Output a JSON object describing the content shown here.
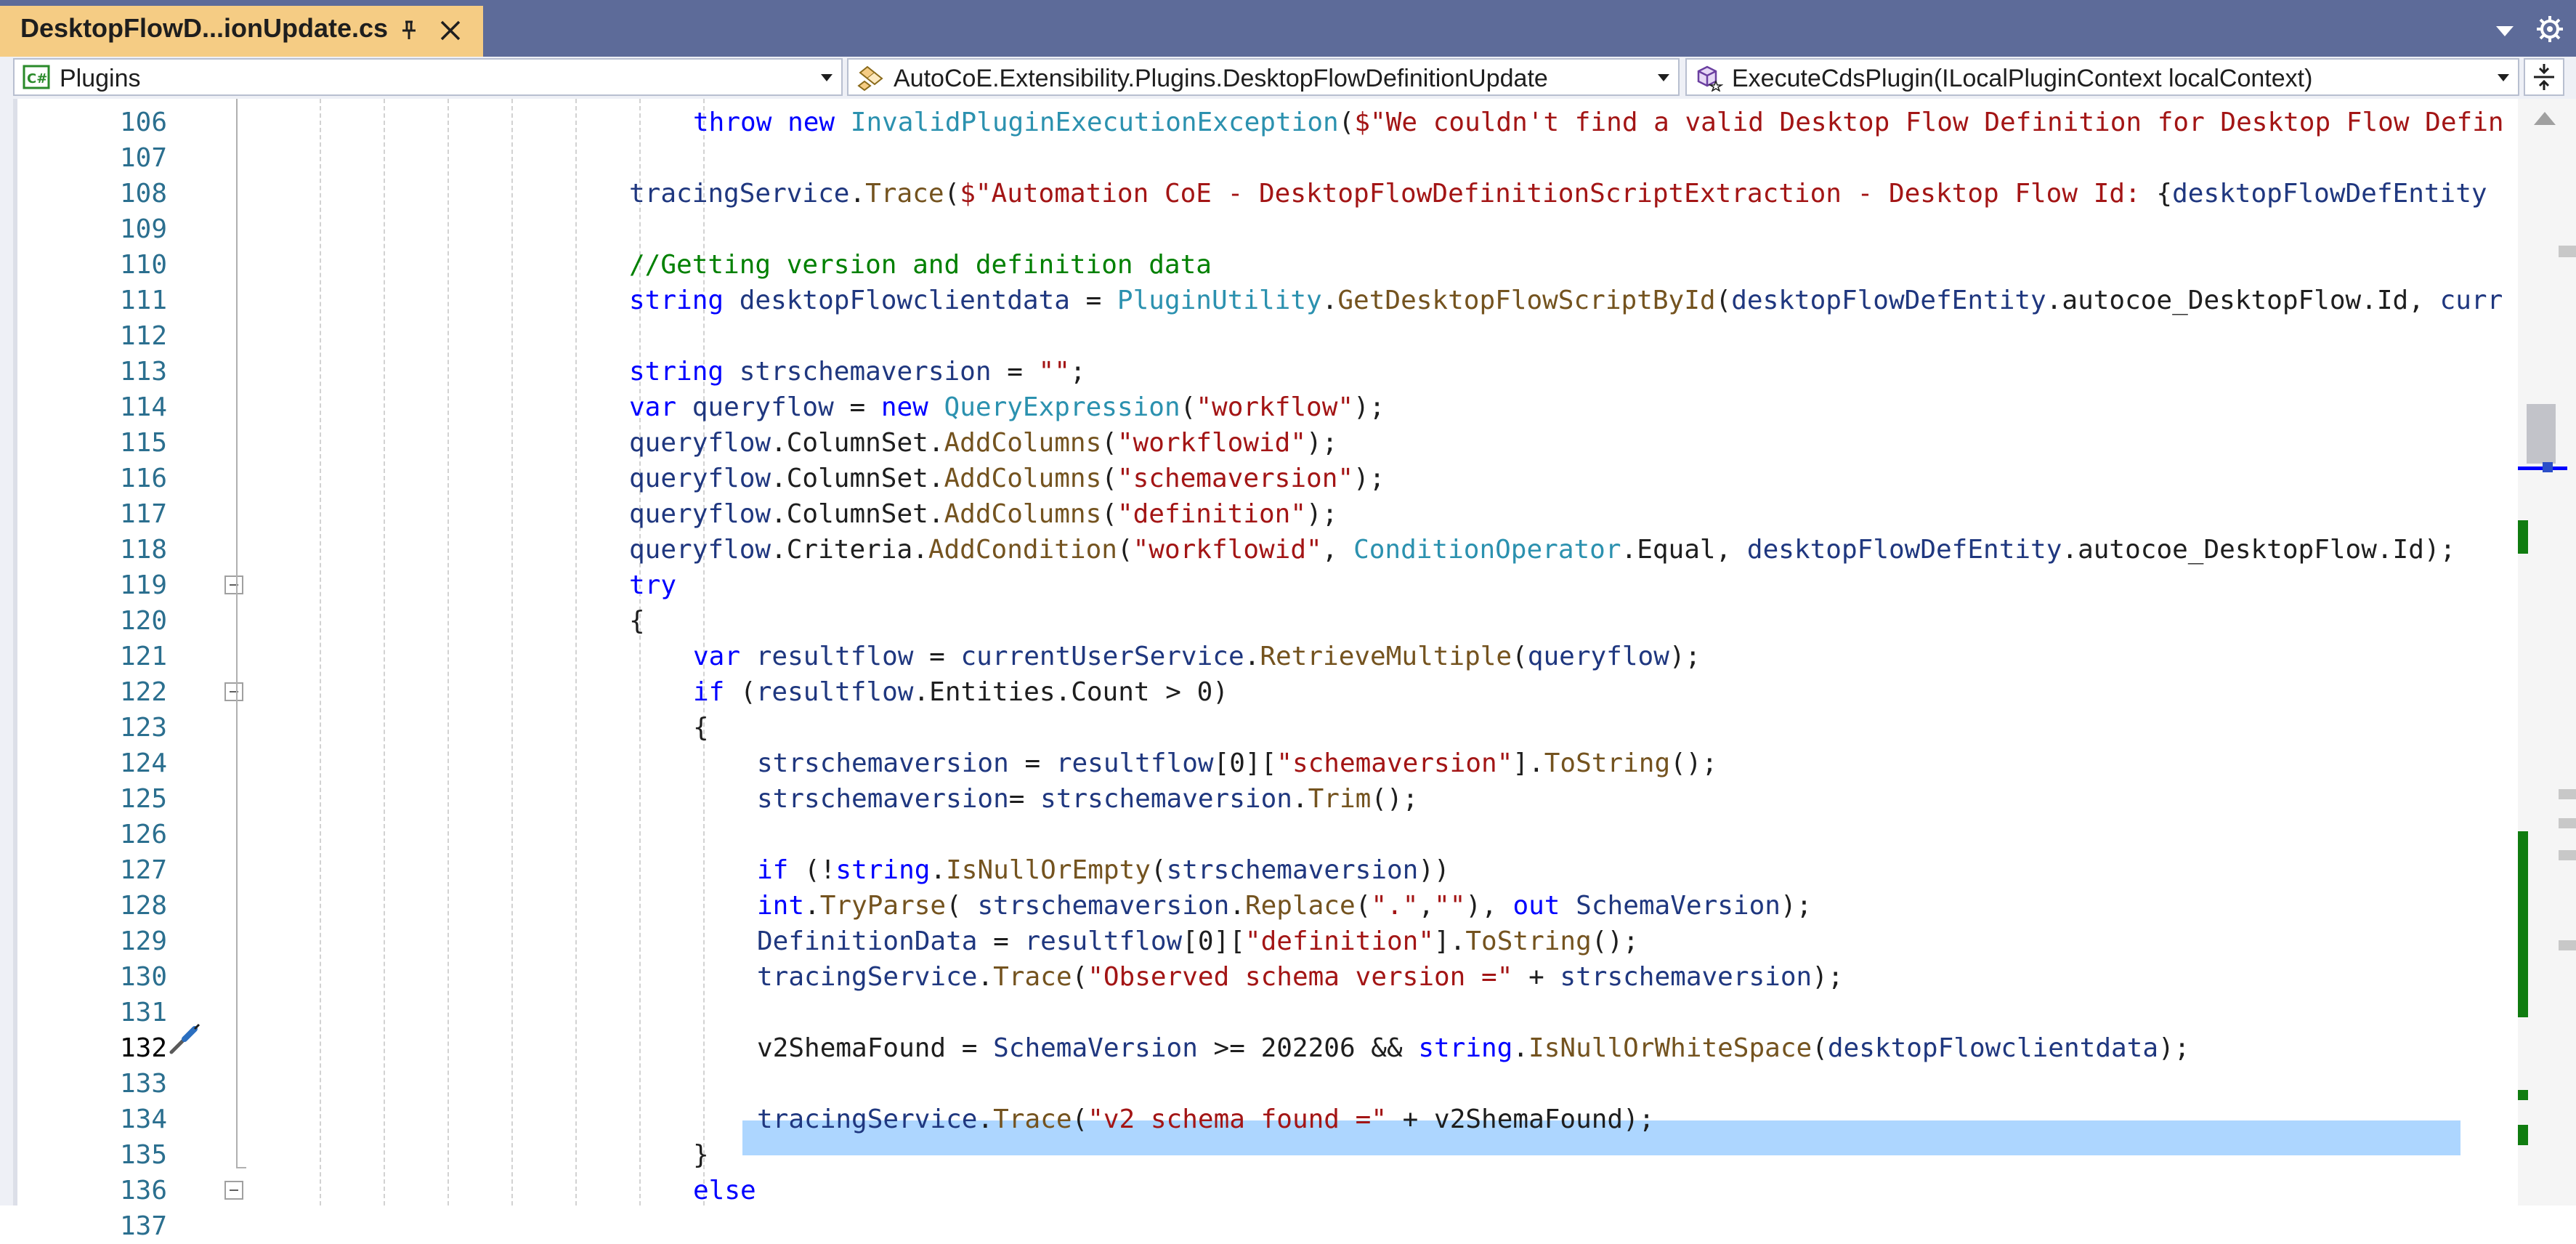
{
  "tab": {
    "title": "DesktopFlowD...ionUpdate.cs",
    "pin_icon": "pin-icon",
    "close_icon": "close-icon"
  },
  "window": {
    "overflow_icon": "chevron-down-icon",
    "settings_icon": "gear-icon"
  },
  "navbar": {
    "project": "Plugins",
    "type": "AutoCoE.Extensibility.Plugins.DesktopFlowDefinitionUpdate",
    "member": "ExecuteCdsPlugin(ILocalPluginContext localContext)"
  },
  "editor": {
    "current_line": "132",
    "colors": {
      "keyword": "#0000ff",
      "type": "#2b91af",
      "string": "#a31515",
      "comment": "#008000",
      "method": "#74531f",
      "variable": "#1f377f",
      "selection": "#add6ff"
    },
    "lines": [
      {
        "num": "106",
        "indent": 2,
        "tokens": [
          [
            "kw",
            "throw"
          ],
          [
            "p",
            " "
          ],
          [
            "kw",
            "new"
          ],
          [
            "p",
            " "
          ],
          [
            "ty",
            "InvalidPluginExecutionException"
          ],
          [
            "p",
            "("
          ],
          [
            "str",
            "$\"We couldn't find a valid Desktop Flow Definition for Desktop Flow Defin"
          ]
        ]
      },
      {
        "num": "107",
        "indent": 0,
        "tokens": []
      },
      {
        "num": "108",
        "indent": 1,
        "tokens": [
          [
            "vr",
            "tracingService"
          ],
          [
            "p",
            "."
          ],
          [
            "mt",
            "Trace"
          ],
          [
            "p",
            "("
          ],
          [
            "str",
            "$\"Automation CoE - DesktopFlowDefinitionScriptExtraction - Desktop Flow Id: "
          ],
          [
            "p",
            "{"
          ],
          [
            "vr",
            "desktopFlowDefEntity"
          ]
        ]
      },
      {
        "num": "109",
        "indent": 0,
        "tokens": []
      },
      {
        "num": "110",
        "indent": 1,
        "tokens": [
          [
            "cm",
            "//Getting version and definition data"
          ]
        ]
      },
      {
        "num": "111",
        "indent": 1,
        "tokens": [
          [
            "kw",
            "string"
          ],
          [
            "p",
            " "
          ],
          [
            "vr",
            "desktopFlowclientdata"
          ],
          [
            "p",
            " = "
          ],
          [
            "ty",
            "PluginUtility"
          ],
          [
            "p",
            "."
          ],
          [
            "mt",
            "GetDesktopFlowScriptById"
          ],
          [
            "p",
            "("
          ],
          [
            "vr",
            "desktopFlowDefEntity"
          ],
          [
            "p",
            ".autocoe_DesktopFlow.Id, "
          ],
          [
            "vr",
            "curr"
          ]
        ]
      },
      {
        "num": "112",
        "indent": 0,
        "tokens": []
      },
      {
        "num": "113",
        "indent": 1,
        "tokens": [
          [
            "kw",
            "string"
          ],
          [
            "p",
            " "
          ],
          [
            "vr",
            "strschemaversion"
          ],
          [
            "p",
            " = "
          ],
          [
            "str",
            "\"\""
          ],
          [
            "p",
            ";"
          ]
        ]
      },
      {
        "num": "114",
        "indent": 1,
        "tokens": [
          [
            "kw",
            "var"
          ],
          [
            "p",
            " "
          ],
          [
            "vr",
            "queryflow"
          ],
          [
            "p",
            " = "
          ],
          [
            "kw",
            "new"
          ],
          [
            "p",
            " "
          ],
          [
            "ty",
            "QueryExpression"
          ],
          [
            "p",
            "("
          ],
          [
            "str",
            "\"workflow\""
          ],
          [
            "p",
            ");"
          ]
        ]
      },
      {
        "num": "115",
        "indent": 1,
        "tokens": [
          [
            "vr",
            "queryflow"
          ],
          [
            "p",
            ".ColumnSet."
          ],
          [
            "mt",
            "AddColumns"
          ],
          [
            "p",
            "("
          ],
          [
            "str",
            "\"workflowid\""
          ],
          [
            "p",
            ");"
          ]
        ]
      },
      {
        "num": "116",
        "indent": 1,
        "tokens": [
          [
            "vr",
            "queryflow"
          ],
          [
            "p",
            ".ColumnSet."
          ],
          [
            "mt",
            "AddColumns"
          ],
          [
            "p",
            "("
          ],
          [
            "str",
            "\"schemaversion\""
          ],
          [
            "p",
            ");"
          ]
        ]
      },
      {
        "num": "117",
        "indent": 1,
        "tokens": [
          [
            "vr",
            "queryflow"
          ],
          [
            "p",
            ".ColumnSet."
          ],
          [
            "mt",
            "AddColumns"
          ],
          [
            "p",
            "("
          ],
          [
            "str",
            "\"definition\""
          ],
          [
            "p",
            ");"
          ]
        ]
      },
      {
        "num": "118",
        "indent": 1,
        "tokens": [
          [
            "vr",
            "queryflow"
          ],
          [
            "p",
            ".Criteria."
          ],
          [
            "mt",
            "AddCondition"
          ],
          [
            "p",
            "("
          ],
          [
            "str",
            "\"workflowid\""
          ],
          [
            "p",
            ", "
          ],
          [
            "ty",
            "ConditionOperator"
          ],
          [
            "p",
            ".Equal, "
          ],
          [
            "vr",
            "desktopFlowDefEntity"
          ],
          [
            "p",
            ".autocoe_DesktopFlow.Id);"
          ]
        ]
      },
      {
        "num": "119",
        "indent": 1,
        "tokens": [
          [
            "kw",
            "try"
          ]
        ],
        "fold": true
      },
      {
        "num": "120",
        "indent": 1,
        "tokens": [
          [
            "p",
            "{"
          ]
        ]
      },
      {
        "num": "121",
        "indent": 2,
        "tokens": [
          [
            "kw",
            "var"
          ],
          [
            "p",
            " "
          ],
          [
            "vr",
            "resultflow"
          ],
          [
            "p",
            " = "
          ],
          [
            "vr",
            "currentUserService"
          ],
          [
            "p",
            "."
          ],
          [
            "mt",
            "RetrieveMultiple"
          ],
          [
            "p",
            "("
          ],
          [
            "vr",
            "queryflow"
          ],
          [
            "p",
            ");"
          ]
        ]
      },
      {
        "num": "122",
        "indent": 2,
        "tokens": [
          [
            "kw",
            "if"
          ],
          [
            "p",
            " ("
          ],
          [
            "vr",
            "resultflow"
          ],
          [
            "p",
            ".Entities.Count > 0)"
          ]
        ],
        "fold": true
      },
      {
        "num": "123",
        "indent": 2,
        "tokens": [
          [
            "p",
            "{"
          ]
        ]
      },
      {
        "num": "124",
        "indent": 3,
        "tokens": [
          [
            "vr",
            "strschemaversion"
          ],
          [
            "p",
            " = "
          ],
          [
            "vr",
            "resultflow"
          ],
          [
            "p",
            "[0]["
          ],
          [
            "str",
            "\"schemaversion\""
          ],
          [
            "p",
            "]."
          ],
          [
            "mt",
            "ToString"
          ],
          [
            "p",
            "();"
          ]
        ]
      },
      {
        "num": "125",
        "indent": 3,
        "tokens": [
          [
            "vr",
            "strschemaversion"
          ],
          [
            "p",
            "= "
          ],
          [
            "vr",
            "strschemaversion"
          ],
          [
            "p",
            "."
          ],
          [
            "mt",
            "Trim"
          ],
          [
            "p",
            "();"
          ]
        ]
      },
      {
        "num": "126",
        "indent": 0,
        "tokens": []
      },
      {
        "num": "127",
        "indent": 3,
        "tokens": [
          [
            "kw",
            "if"
          ],
          [
            "p",
            " (!"
          ],
          [
            "kw",
            "string"
          ],
          [
            "p",
            "."
          ],
          [
            "mt",
            "IsNullOrEmpty"
          ],
          [
            "p",
            "("
          ],
          [
            "vr",
            "strschemaversion"
          ],
          [
            "p",
            "))"
          ]
        ]
      },
      {
        "num": "128",
        "indent": 3,
        "tokens": [
          [
            "kw",
            "int"
          ],
          [
            "p",
            "."
          ],
          [
            "mt",
            "TryParse"
          ],
          [
            "p",
            "( "
          ],
          [
            "vr",
            "strschemaversion"
          ],
          [
            "p",
            "."
          ],
          [
            "mt",
            "Replace"
          ],
          [
            "p",
            "("
          ],
          [
            "str",
            "\".\""
          ],
          [
            "p",
            ","
          ],
          [
            "str",
            "\"\""
          ],
          [
            "p",
            "), "
          ],
          [
            "kw",
            "out"
          ],
          [
            "p",
            " "
          ],
          [
            "vr",
            "SchemaVersion"
          ],
          [
            "p",
            ");"
          ]
        ]
      },
      {
        "num": "129",
        "indent": 3,
        "tokens": [
          [
            "vr",
            "DefinitionData"
          ],
          [
            "p",
            " = "
          ],
          [
            "vr",
            "resultflow"
          ],
          [
            "p",
            "[0]["
          ],
          [
            "str",
            "\"definition\""
          ],
          [
            "p",
            "]."
          ],
          [
            "mt",
            "ToString"
          ],
          [
            "p",
            "();"
          ]
        ]
      },
      {
        "num": "130",
        "indent": 3,
        "tokens": [
          [
            "vr",
            "tracingService"
          ],
          [
            "p",
            "."
          ],
          [
            "mt",
            "Trace"
          ],
          [
            "p",
            "("
          ],
          [
            "str",
            "\"Observed schema version =\""
          ],
          [
            "p",
            " + "
          ],
          [
            "vr",
            "strschemaversion"
          ],
          [
            "p",
            ");"
          ]
        ]
      },
      {
        "num": "131",
        "indent": 0,
        "tokens": []
      },
      {
        "num": "132",
        "indent": 3,
        "tokens": [
          [
            "p",
            "v2ShemaFound = "
          ],
          [
            "vr",
            "SchemaVersion"
          ],
          [
            "p",
            " >= 202206 && "
          ],
          [
            "kw",
            "string"
          ],
          [
            "p",
            "."
          ],
          [
            "mt",
            "IsNullOrWhiteSpace"
          ],
          [
            "p",
            "("
          ],
          [
            "vr",
            "desktopFlowclientdata"
          ],
          [
            "p",
            ");"
          ]
        ],
        "selected": true
      },
      {
        "num": "133",
        "indent": 0,
        "tokens": []
      },
      {
        "num": "134",
        "indent": 3,
        "tokens": [
          [
            "vr",
            "tracingService"
          ],
          [
            "p",
            "."
          ],
          [
            "mt",
            "Trace"
          ],
          [
            "p",
            "("
          ],
          [
            "str",
            "\"v2 schema found =\""
          ],
          [
            "p",
            " + v2ShemaFound);"
          ]
        ]
      },
      {
        "num": "135",
        "indent": 2,
        "tokens": [
          [
            "p",
            "}"
          ]
        ]
      },
      {
        "num": "136",
        "indent": 2,
        "tokens": [
          [
            "kw",
            "else"
          ]
        ],
        "fold": true
      },
      {
        "num": "137",
        "indent": 2,
        "tokens": [
          [
            "p",
            "{"
          ]
        ]
      }
    ]
  }
}
